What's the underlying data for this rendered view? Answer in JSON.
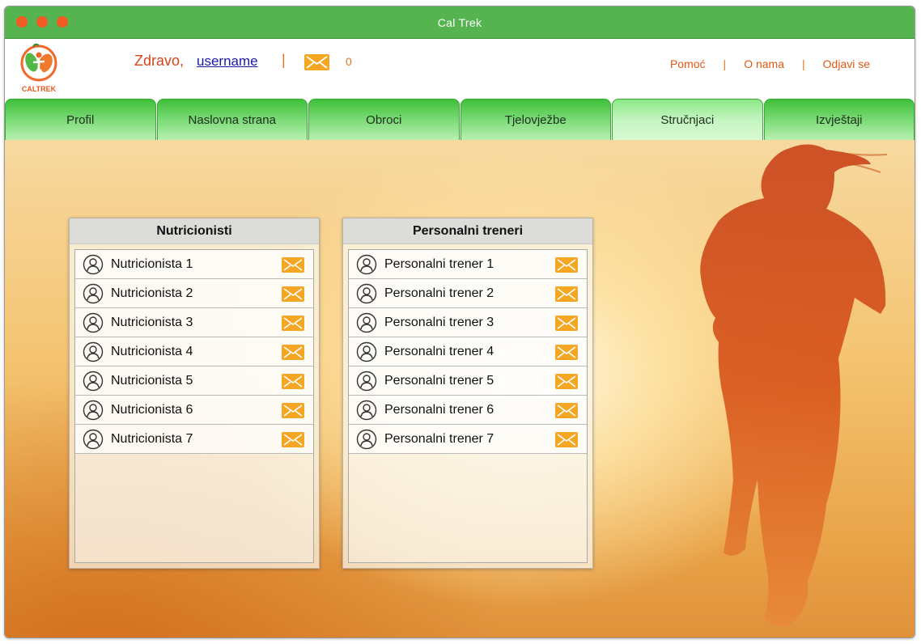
{
  "window": {
    "title": "Cal Trek"
  },
  "header": {
    "greeting": "Zdravo,",
    "username": "username",
    "separator": "|",
    "message_count": "0",
    "links": [
      "Pomoć",
      "O nama",
      "Odjavi se"
    ]
  },
  "logo": {
    "text": "CALTREK"
  },
  "tabs": [
    {
      "label": "Profil",
      "active": false
    },
    {
      "label": "Naslovna strana",
      "active": false
    },
    {
      "label": "Obroci",
      "active": false
    },
    {
      "label": "Tjelovježbe",
      "active": false
    },
    {
      "label": "Stručnjaci",
      "active": true
    },
    {
      "label": "Izvještaji",
      "active": false
    }
  ],
  "panels": {
    "nutritionists": {
      "title": "Nutricionisti",
      "items": [
        "Nutricionista 1",
        "Nutricionista 2",
        "Nutricionista 3",
        "Nutricionista 4",
        "Nutricionista 5",
        "Nutricionista 6",
        "Nutricionista 7"
      ]
    },
    "trainers": {
      "title": "Personalni treneri",
      "items": [
        "Personalni trener 1",
        "Personalni trener 2",
        "Personalni trener 3",
        "Personalni trener 4",
        "Personalni trener 5",
        "Personalni trener 6",
        "Personalni trener 7"
      ]
    }
  },
  "icons": {
    "user": "user-outline-icon",
    "mail": "envelope-icon",
    "window_controls": "traffic-light-dots"
  },
  "colors": {
    "titlebar": "#55b350",
    "accent_orange": "#f5a623",
    "header_text": "#d94418",
    "window_dot": "#f25a23"
  }
}
